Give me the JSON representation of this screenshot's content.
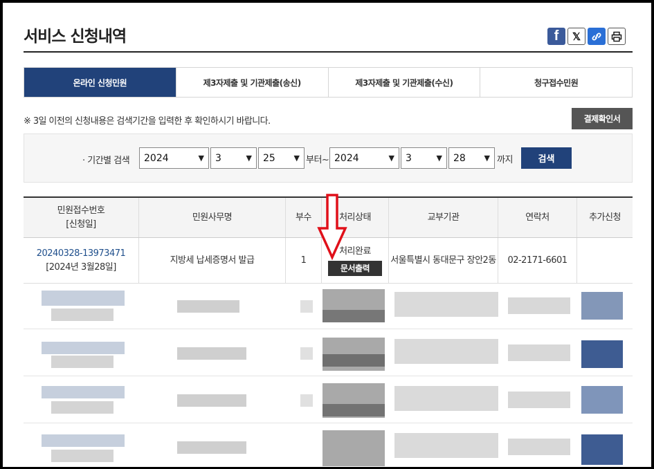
{
  "header": {
    "title": "서비스 신청내역"
  },
  "share": {
    "facebook_glyph": "f",
    "x_glyph": "𝕏",
    "link_glyph": "🔗",
    "print_glyph": "🖶"
  },
  "tabs": [
    {
      "label": "온라인 신청민원",
      "active": true
    },
    {
      "label": "제3자제출 및 기관제출(송신)",
      "active": false
    },
    {
      "label": "제3자제출 및 기관제출(수신)",
      "active": false
    },
    {
      "label": "청구접수민원",
      "active": false
    }
  ],
  "notice": {
    "text": "※ 3일 이전의 신청내용은 검색기간을 입력한 후 확인하시기 바랍니다.",
    "button": "결제확인서"
  },
  "search": {
    "label": "· 기간별 검색",
    "from_year": "2024",
    "from_month": "3",
    "from_day": "25",
    "from_suffix": "부터~",
    "to_year": "2024",
    "to_month": "3",
    "to_day": "28",
    "to_suffix": "까지",
    "button": "검색"
  },
  "table": {
    "headers": [
      "민원접수번호",
      "[신청일]",
      "민원사무명",
      "부수",
      "처리상태",
      "교부기관",
      "연락처",
      "추가신청"
    ],
    "row": {
      "receipt_no": "20240328-13973471",
      "apply_date": "[2024년 3월28일]",
      "service_name": "지방세 납세증명서 발급",
      "copies": "1",
      "status": "처리완료",
      "doc_button": "문서출력",
      "office": "서울특별시 동대문구 장안2동",
      "phone": "02-2171-6601",
      "extra": ""
    }
  },
  "colors": {
    "accent": "#21427a",
    "arrow": "#e0101a",
    "button_dark": "#333333"
  }
}
